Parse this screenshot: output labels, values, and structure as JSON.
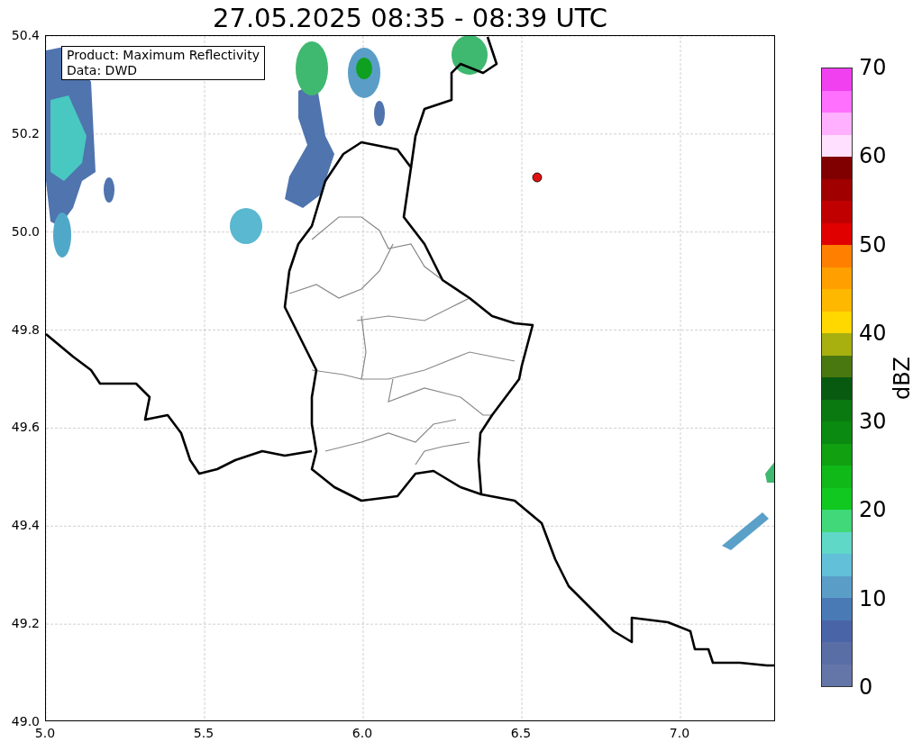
{
  "title": "27.05.2025 08:35 - 08:39 UTC",
  "plot": {
    "x_ticks": [
      "5.0",
      "5.5",
      "6.0",
      "6.5",
      "7.0"
    ],
    "y_ticks": [
      "50.4",
      "50.2",
      "50.0",
      "49.8",
      "49.6",
      "49.4",
      "49.2",
      "49.0"
    ],
    "info_box": {
      "lines": [
        "Product: Maximum Reflectivity",
        "Data: DWD"
      ]
    }
  },
  "colorbar": {
    "label": "dBZ",
    "ticks": [
      "70",
      "60",
      "50",
      "40",
      "30",
      "20",
      "10",
      "0"
    ],
    "segments": [
      {
        "color": "#6476a8"
      },
      {
        "color": "#5a6ea6"
      },
      {
        "color": "#4a64a8"
      },
      {
        "color": "#4a7ab5"
      },
      {
        "color": "#5a9ec8"
      },
      {
        "color": "#62c0d8"
      },
      {
        "color": "#60d8c8"
      },
      {
        "color": "#40d878"
      },
      {
        "color": "#10c820"
      },
      {
        "color": "#10b818"
      },
      {
        "color": "#10a010"
      },
      {
        "color": "#0a8a10"
      },
      {
        "color": "#0a7a10"
      },
      {
        "color": "#085a10"
      },
      {
        "color": "#4a7810"
      },
      {
        "color": "#a8b010"
      },
      {
        "color": "#ffd800"
      },
      {
        "color": "#ffb800"
      },
      {
        "color": "#ffa000"
      },
      {
        "color": "#ff8000"
      },
      {
        "color": "#e00000"
      },
      {
        "color": "#c00000"
      },
      {
        "color": "#a00000"
      },
      {
        "color": "#800000"
      },
      {
        "color": "#ffe0ff"
      },
      {
        "color": "#ffb0ff"
      },
      {
        "color": "#ff70ff"
      },
      {
        "color": "#f040f0"
      }
    ]
  }
}
